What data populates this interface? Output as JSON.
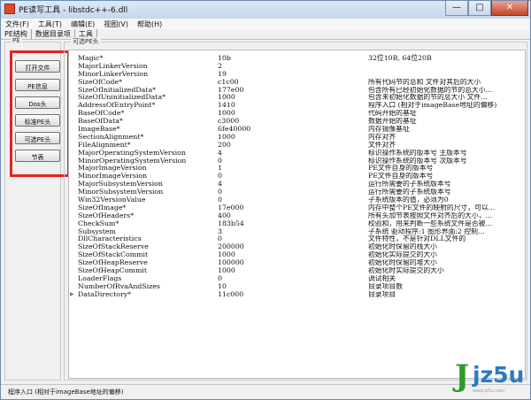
{
  "window": {
    "title": "PE读写工具 - libstdc++-6.dll",
    "minimize": "—",
    "maximize": "□",
    "close": "✕"
  },
  "menu": [
    "文件(F)",
    "工具(T)",
    "编辑(E)",
    "视图(V)",
    "帮助(H)"
  ],
  "tabs": [
    "PE结构",
    "数据目录项",
    "工具"
  ],
  "left_group": {
    "legend": "PE",
    "buttons": [
      "打开文件",
      "PE信息",
      "Dos头",
      "标准PE头",
      "可选PE头",
      "节表"
    ]
  },
  "right_group": {
    "legend": "可选PE头"
  },
  "rows": [
    {
      "name": "Magic*",
      "value": "10b",
      "desc": "",
      "extra": "32位10B, 64位20B"
    },
    {
      "name": "MajorLinkerVersion",
      "value": "2",
      "desc": "",
      "extra": ""
    },
    {
      "name": "MinorLinkerVersion",
      "value": "19",
      "desc": "",
      "extra": ""
    },
    {
      "name": "SizeOfCode*",
      "value": "c1c00",
      "desc": "所有代码节的总和 文件对其后的大小",
      "extra": ""
    },
    {
      "name": "SizeOfInitializedData*",
      "value": "177e00",
      "desc": "包含所有已经初始化数据的节的总大小…",
      "extra": ""
    },
    {
      "name": "SizeOfUninitializedData*",
      "value": "1000",
      "desc": "包含未初始化数据的节的总大小 文件…",
      "extra": ""
    },
    {
      "name": "AddressOfEntryPoint*",
      "value": "1410",
      "desc": "程序入口 (相对于imageBase地址的偏移)",
      "extra": ""
    },
    {
      "name": "BaseOfCode*",
      "value": "1000",
      "desc": "代码开始的基址",
      "extra": ""
    },
    {
      "name": "BaseOfData*",
      "value": "c3000",
      "desc": "数据开始的基址",
      "extra": ""
    },
    {
      "name": "ImageBase*",
      "value": "6fe40000",
      "desc": "内存镜像基址",
      "extra": ""
    },
    {
      "name": "SectionAlignment*",
      "value": "1000",
      "desc": "内存对齐",
      "extra": ""
    },
    {
      "name": "FileAlignment*",
      "value": "200",
      "desc": "文件对齐",
      "extra": ""
    },
    {
      "name": "MajorOperatingSystemVersion",
      "value": "4",
      "desc": "标识操作系统的版本号 主版本号",
      "extra": ""
    },
    {
      "name": "MinorOperatingSystemVersion",
      "value": "0",
      "desc": "标识操作系统的版本号 次版本号",
      "extra": ""
    },
    {
      "name": "MajorImageVersion",
      "value": "1",
      "desc": "PE文件自身的版本号",
      "extra": ""
    },
    {
      "name": "MinorImageVersion",
      "value": "0",
      "desc": "PE文件自身的版本号",
      "extra": ""
    },
    {
      "name": "MajorSubsystemVersion",
      "value": "4",
      "desc": "运行所需要的子系统版本号",
      "extra": ""
    },
    {
      "name": "MinorSubsystemVersion",
      "value": "0",
      "desc": "运行所需要的子系统版本号",
      "extra": ""
    },
    {
      "name": "Win32VersionValue",
      "value": "0",
      "desc": "子系统版本的值，必须为0",
      "extra": ""
    },
    {
      "name": "SizeOfImage*",
      "value": "17e000",
      "desc": "内存中整个PE文件的映射的尺寸，可以…",
      "extra": ""
    },
    {
      "name": "SizeOfHeaders*",
      "value": "400",
      "desc": "所有头加节表按照文件对齐后的大小，…",
      "extra": ""
    },
    {
      "name": "CheckSum*",
      "value": "183b54",
      "desc": "校验和，用来判断一些系统文件是否被…",
      "extra": ""
    },
    {
      "name": "Subsystem",
      "value": "3",
      "desc": "子系统 驱动程序:1 图形界面:2 控制…",
      "extra": ""
    },
    {
      "name": "DllCharacteristics",
      "value": "0",
      "desc": "文件特性，不是针对DLL文件的",
      "extra": ""
    },
    {
      "name": "SizeOfStackReserve",
      "value": "200000",
      "desc": "初始化时保留的栈大小",
      "extra": ""
    },
    {
      "name": "SizeOfStackCommit",
      "value": "1000",
      "desc": "初始化实际提交的大小",
      "extra": ""
    },
    {
      "name": "SizeOfHeapReserve",
      "value": "100000",
      "desc": "初始化时保留的堆大小",
      "extra": ""
    },
    {
      "name": "SizeOfHeapCommit",
      "value": "1000",
      "desc": "初始化时实际提交的大小",
      "extra": ""
    },
    {
      "name": "LoaderFlags",
      "value": "0",
      "desc": "调试相关",
      "extra": ""
    },
    {
      "name": "NumberOfRvaAndSizes",
      "value": "10",
      "desc": "目录项目数",
      "extra": ""
    },
    {
      "name": "DataDirectory*",
      "value": "11c000",
      "desc": "目录项目",
      "extra": "",
      "expandable": true
    }
  ],
  "status": {
    "text": "程序入口 (相对于imageBase地址的偏移)"
  },
  "watermark": {
    "logo_j": "J",
    "logo_text": "jz5u",
    "sub": "www.jz5u.com"
  },
  "colors": {
    "highlight": "#e32222",
    "titlebar": "#c5d7ec",
    "watermark_green": "#2f9a2a",
    "watermark_blue": "#2b7bbf"
  }
}
